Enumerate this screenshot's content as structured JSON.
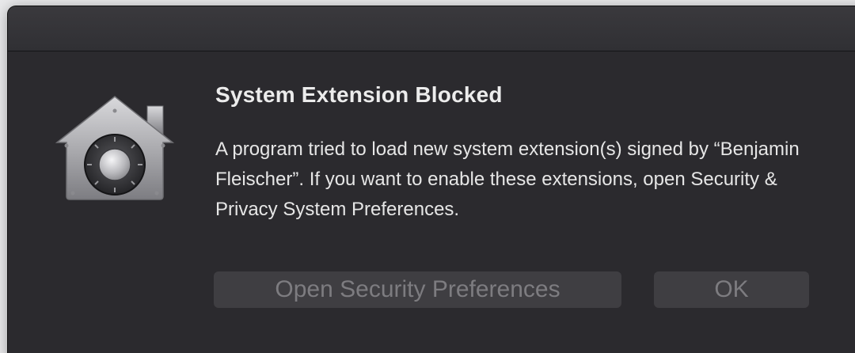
{
  "dialog": {
    "title": "System Extension Blocked",
    "message": "A program tried to load new system extension(s) signed by “Benjamin Fleischer”. If you want to enable these extensions, open Security & Privacy System Preferences.",
    "icon": "security-lock-house-icon"
  },
  "buttons": {
    "open_security_preferences": "Open Security Preferences",
    "ok": "OK"
  },
  "colors": {
    "dialog_background": "#2b2a2e",
    "title_text": "#ececec",
    "body_text": "#e6e6e6",
    "button_background": "#3f3e42",
    "button_text": "#7d7c80"
  }
}
